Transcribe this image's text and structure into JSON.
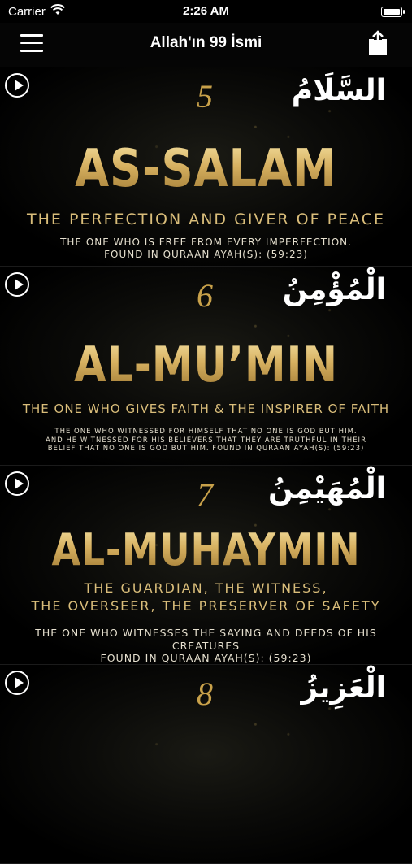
{
  "status": {
    "carrier": "Carrier",
    "time": "2:26 AM"
  },
  "nav": {
    "title": "Allah'ın 99 İsmi"
  },
  "cards": [
    {
      "number": "5",
      "arabic": "السَّلَامُ",
      "name": "AS-SALAM",
      "subtitle": "THE PERFECTION AND GIVER OF PEACE",
      "description": "THE ONE WHO IS FREE FROM EVERY IMPERFECTION.\nFOUND IN QURAAN AYAH(S): (59:23)"
    },
    {
      "number": "6",
      "arabic": "الْمُؤْمِنُ",
      "name": "AL-MU’MIN",
      "subtitle": "THE ONE WHO GIVES FAITH & THE INSPIRER OF FAITH",
      "description": "THE ONE WHO WITNESSED FOR HIMSELF THAT NO ONE IS GOD BUT HIM.\nAND HE WITNESSED FOR HIS BELIEVERS THAT THEY ARE TRUTHFUL IN THEIR\nBELIEF THAT NO ONE IS GOD BUT HIM. FOUND IN QURAAN AYAH(S): (59:23)"
    },
    {
      "number": "7",
      "arabic": "الْمُهَيْمِنُ",
      "name": "AL-MUHAYMIN",
      "subtitle": "THE GUARDIAN, THE WITNESS,\nTHE OVERSEER, THE PRESERVER OF SAFETY",
      "description": "THE ONE WHO WITNESSES THE SAYING AND DEEDS OF HIS CREATURES\nFOUND IN QURAAN AYAH(S): (59:23)"
    },
    {
      "number": "8",
      "arabic": "الْعَزِيزُ",
      "name": "",
      "subtitle": "",
      "description": ""
    }
  ]
}
